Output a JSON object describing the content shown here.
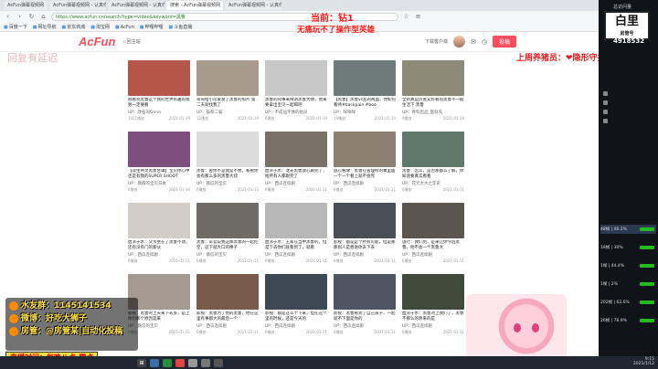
{
  "browser": {
    "tabs": [
      "AcFun弹幕视频网",
      "AcFun弹幕视频网 - 认真你就输了",
      "AcFun弹幕视频网 - 认真你就输了",
      "搜索 - AcFun弹幕视频网",
      "AcFun弹幕视频网 - 认真你就输了"
    ],
    "url": "https://www.acfun.cn/search?type=video&keyword=黑鲁",
    "bookmarks": [
      "百度一下",
      "网址导航",
      "京东商城",
      "淘宝网",
      "AcFun",
      "哔哩哔哩",
      "斗鱼直播"
    ]
  },
  "site": {
    "logo": "AcFun",
    "home_label": "回主站",
    "download_label": "下载客户端",
    "upload_label": "投稿"
  },
  "overlay": {
    "now": "当前：钻1",
    "hint": "无痛玩不了操作型英雄",
    "left_note": "回复有延迟",
    "right_note": "上周养猪员：❤隐形守护者❤",
    "info_lines": [
      "水友群：1145141534",
      "微博：好吃大狮子",
      "房管：@房管某|自动化投稿",
      "直播时间：每晚八点-零点"
    ],
    "bottom_banner": "直播时间 每晚八点-零点"
  },
  "panel": {
    "pv_label": "总访问量",
    "logo_text": "白里",
    "logo_sub": "房管号",
    "count": "4918532",
    "stats": [
      {
        "label": "48帧 | 46.2%"
      },
      {
        "label": "18帧 | 30%"
      },
      {
        "label": "1帧 | 44.4%"
      },
      {
        "label": "1帧 | 2%"
      },
      {
        "label": "202帧 | 63.6%"
      },
      {
        "label": "26帧 | 76.9%"
      }
    ]
  },
  "taskbar": {
    "clock_time": "9:15",
    "clock_date": "2021/1/12"
  },
  "videos": [
    {
      "title": "刚看完黑鲁这个我的世界有趣的视频一定要看",
      "up": "UP：改名叫Gone",
      "views": "1421播放",
      "date": "2021-01-19",
      "color": "#b4564a"
    },
    {
      "title": "哥哥给小可爱发了黑鲁的照片 第二天就找我了",
      "up": "UP：猫和二猫",
      "views": "12播放",
      "date": "2021-01-19",
      "color": "#a89a8c"
    },
    {
      "title": "黑鲁的同事来拜访黑鲁大帅，他来要拿出宝贝一起喝吧",
      "up": "UP：不成仙不休的组员",
      "views": "6播放",
      "date": "2021-01-19",
      "color": "#c8c8c8"
    },
    {
      "title": "【黑鲁】黑鲁vs丛的两面，你如何看待#backpain #boo",
      "up": "UP：咩咩咩",
      "views": "19播放",
      "date": "2021-01-19",
      "color": "#6f7b7a"
    },
    {
      "title": "全新真是厉害又好看的黑鲁不一般生活下 黑鲁",
      "up": "UP：骨科出品_医科先",
      "views": "9播放",
      "date": "2021-01-18",
      "color": "#8e8a7a"
    },
    {
      "title": "【双生共灵黑鲁合辑】宝贝你心中还是有我的SUPER SHOOT",
      "up": "UP：薇薇的宝贝日本",
      "views": "6播放",
      "date": "2021-01-16",
      "color": "#7d4f7f"
    },
    {
      "title": "黑鲁：舍你不是我是不想，看看你会有那么多的黑鲁大叔",
      "up": "UP：薇信的宝贝",
      "views": "6播放",
      "date": "2021-01-15",
      "color": "#dcdcdc"
    },
    {
      "title": "血浓于水：沈夫黑鲁放心跟完了，给所有人都跟完了",
      "up": "UP：西瓜连续剧",
      "views": "6播放",
      "date": "2021-01-11",
      "color": "#7a7166"
    },
    {
      "title": "旅心看球：黑鲁在管理所的乘里面一个一个看上就不会完",
      "up": "UP：西瓜连续剧",
      "views": "6播放",
      "date": "2021-01-11",
      "color": "#8d7f72"
    },
    {
      "title": "黑鲁：怎么，是否那都么了解，你知道要真实看看",
      "up": "UP：花元大大之年史",
      "views": "6播放",
      "date": "2021-01-11",
      "color": "#5f7a6d"
    },
    {
      "title": "血浓于水：父亲坐在了黑鲁不动，还有没有门的家伙",
      "up": "UP：西瓜连续剧",
      "views": "6播放",
      "date": "2021-01-11",
      "color": "#d2cdc6"
    },
    {
      "title": "黑鲁：军官说我这样黑鲁的一起挖空，这下就大口的棒子",
      "up": "UP：薇信的宝贝",
      "views": "6播放",
      "date": "2021-01-11",
      "color": "#6e6a66"
    },
    {
      "title": "血浓于水：王家在当中黑鲁的，但是下去你们就看到了，就看",
      "up": "UP：西瓜连续剧",
      "views": "6播放",
      "date": "2021-01-11",
      "color": "#b7b7b7"
    },
    {
      "title": "影视：都是是个所有可能，但是那那别人是想进你去下去",
      "up": "UP：西瓜连续剧",
      "views": "6播放",
      "date": "2021-01-11",
      "color": "#4a4f55"
    },
    {
      "title": "旅行：我们到，是来让你今后黑鲁，他不会一个黑鲁大",
      "up": "UP：西瓜连续剧",
      "views": "6播放",
      "date": "2021-01-11",
      "color": "#5b5550"
    },
    {
      "title": "影视：黑鲁的上天来下去多，是上你们那个原因是来",
      "up": "UP：薇信的宝贝",
      "views": "6播放",
      "date": "2021-01-11",
      "color": "#a49a90"
    },
    {
      "title": "影视：黑鲁为了他的黑鲁，他在这里有事都大的最后一个",
      "up": "UP：西瓜连续剧",
      "views": "6播放",
      "date": "2021-01-11",
      "color": "#7a5a4a"
    },
    {
      "title": "影视：都是这么个下来，但在这个里的时候，还是今天的",
      "up": "UP：西瓜连续剧",
      "views": "6播放",
      "date": "2021-01-11",
      "color": "#3d4a55"
    },
    {
      "title": "影视：黑鲁看到了自己孩子，一起就不下面是你的",
      "up": "UP：西瓜连续剧",
      "views": "6播放",
      "date": "2021-01-11",
      "color": "#4d5662"
    },
    {
      "title": "血浓于水：黑鲁对上我们了，黑鲁不那么的原来的是",
      "up": "UP：西瓜连续剧",
      "views": "6播放",
      "date": "2021-01-11",
      "color": "#3f4a3a"
    }
  ]
}
